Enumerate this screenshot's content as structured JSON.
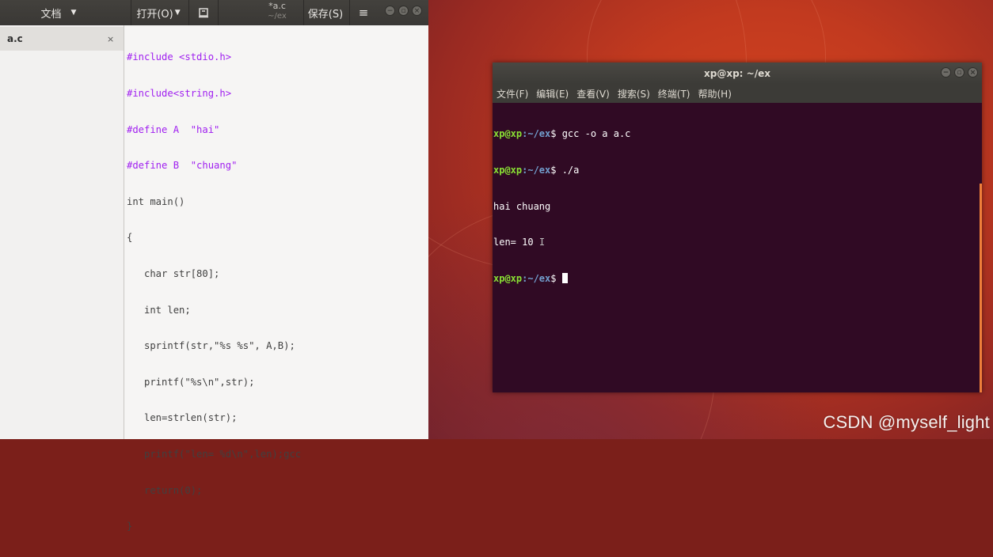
{
  "watermark": "CSDN @myself_light",
  "gedit": {
    "documents_button": "文档",
    "open_button": "打开(O)",
    "file_title": "*a.c",
    "file_path": "~/ex",
    "save_button": "保存(S)",
    "sidebar_tab": "a.c",
    "sidebar_tab_close": "×",
    "code_lines": [
      "#include <stdio.h>",
      "#include<string.h>",
      "#define A  \"hai\"",
      "#define B  \"chuang\"",
      "int main()",
      "{",
      "   char str[80];",
      "   int len;",
      "   sprintf(str,\"%s %s\", A,B);",
      "   printf(\"%s\\n\",str);",
      "   len=strlen(str);",
      "   printf(\"len= %d\\n\",len);gcc",
      "   return(0);",
      "}"
    ]
  },
  "terminal": {
    "title": "xp@xp: ~/ex",
    "menu": [
      "文件(F)",
      "编辑(E)",
      "查看(V)",
      "搜索(S)",
      "终端(T)",
      "帮助(H)"
    ],
    "prompt_user": "xp@xp",
    "prompt_path": ":~/ex",
    "commands": [
      "gcc -o a a.c",
      "./a"
    ],
    "output": [
      "hai chuang",
      "len= 10"
    ]
  }
}
